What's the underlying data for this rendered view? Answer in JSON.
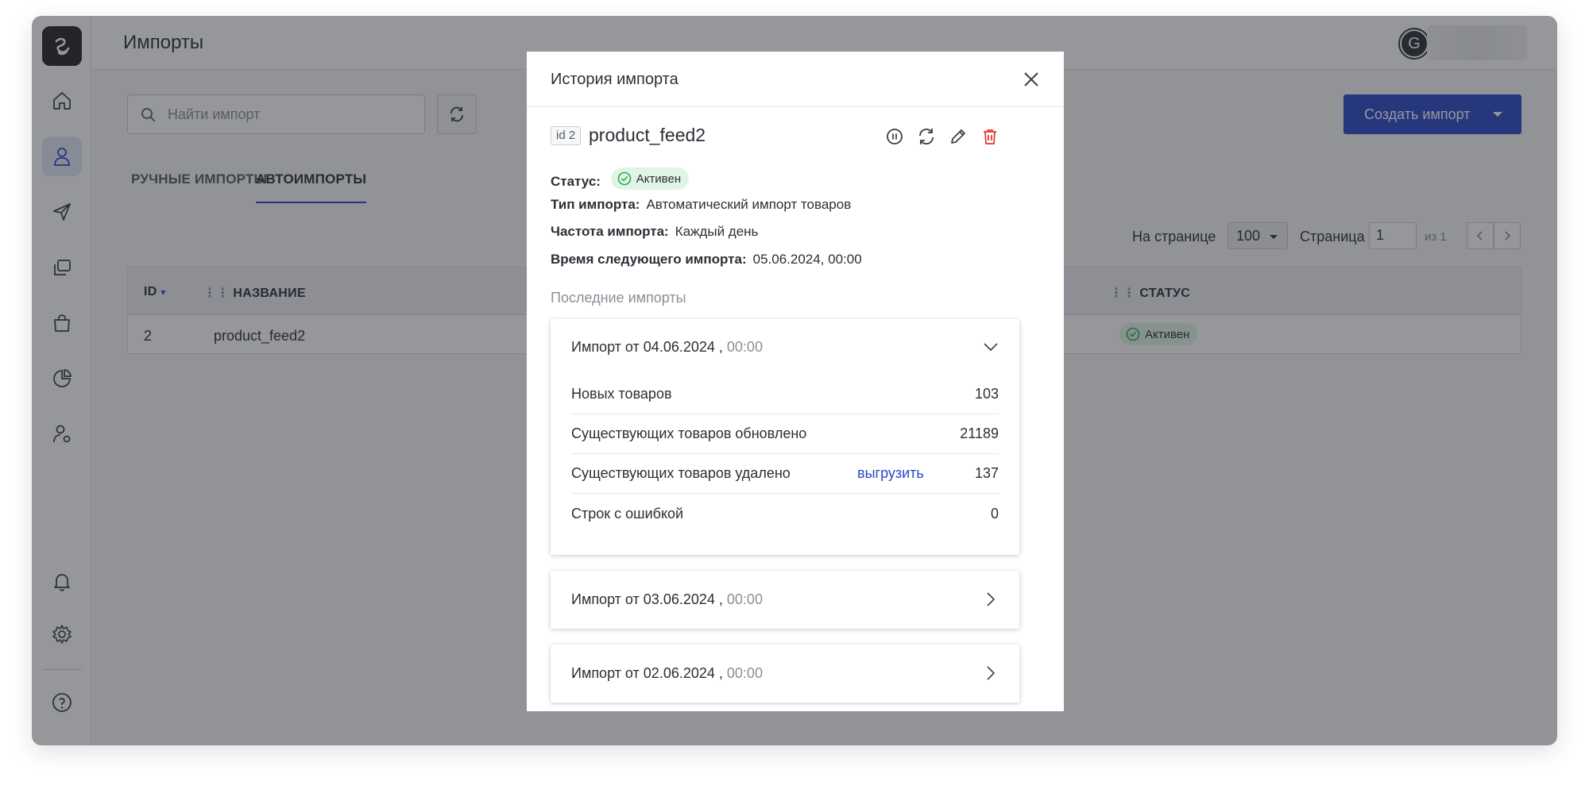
{
  "topbar": {
    "title": "Импорты",
    "avatar_letter": "G"
  },
  "search": {
    "placeholder": "Найти импорт"
  },
  "create_button": {
    "label": "Создать импорт"
  },
  "tabs": [
    {
      "label": "РУЧНЫЕ ИМПОРТЫ",
      "active": false
    },
    {
      "label": "АВТОИМПОРТЫ",
      "active": true
    }
  ],
  "pager": {
    "per_page_label": "На странице",
    "per_page_value": "100",
    "page_label": "Страница",
    "page_value": "1",
    "of_text": "из 1"
  },
  "table": {
    "columns": [
      "ID",
      "НАЗВАНИЕ",
      "СТАТУС"
    ],
    "rows": [
      {
        "id": "2",
        "name": "product_feed2",
        "status": "Активен"
      }
    ]
  },
  "modal": {
    "title": "История импорта",
    "id_chip": "id 2",
    "feed_name": "product_feed2",
    "status_label": "Статус:",
    "status_value": "Активен",
    "type_label": "Тип импорта:",
    "type_value": "Автоматический импорт товаров",
    "freq_label": "Частота импорта:",
    "freq_value": "Каждый день",
    "next_label": "Время следующего импорта:",
    "next_value": "05.06.2024, 00:00",
    "recent_label": "Последние импорты",
    "imports": [
      {
        "title": "Импорт от 04.06.2024 ,",
        "time": "00:00",
        "expanded": true,
        "stats": [
          {
            "label": "Новых товаров",
            "value": "103"
          },
          {
            "label": "Существующих товаров обновлено",
            "value": "21189"
          },
          {
            "label": "Существующих товаров удалено",
            "value": "137",
            "link": "выгрузить"
          },
          {
            "label": "Строк с ошибкой",
            "value": "0"
          }
        ]
      },
      {
        "title": "Импорт от 03.06.2024 ,",
        "time": "00:00",
        "expanded": false
      },
      {
        "title": "Импорт от 02.06.2024 ,",
        "time": "00:00",
        "expanded": false
      }
    ]
  },
  "colors": {
    "accent": "#2a47c9",
    "status_bg": "#e1f5e6",
    "status_icon": "#2fa84f",
    "danger": "#e53935"
  }
}
